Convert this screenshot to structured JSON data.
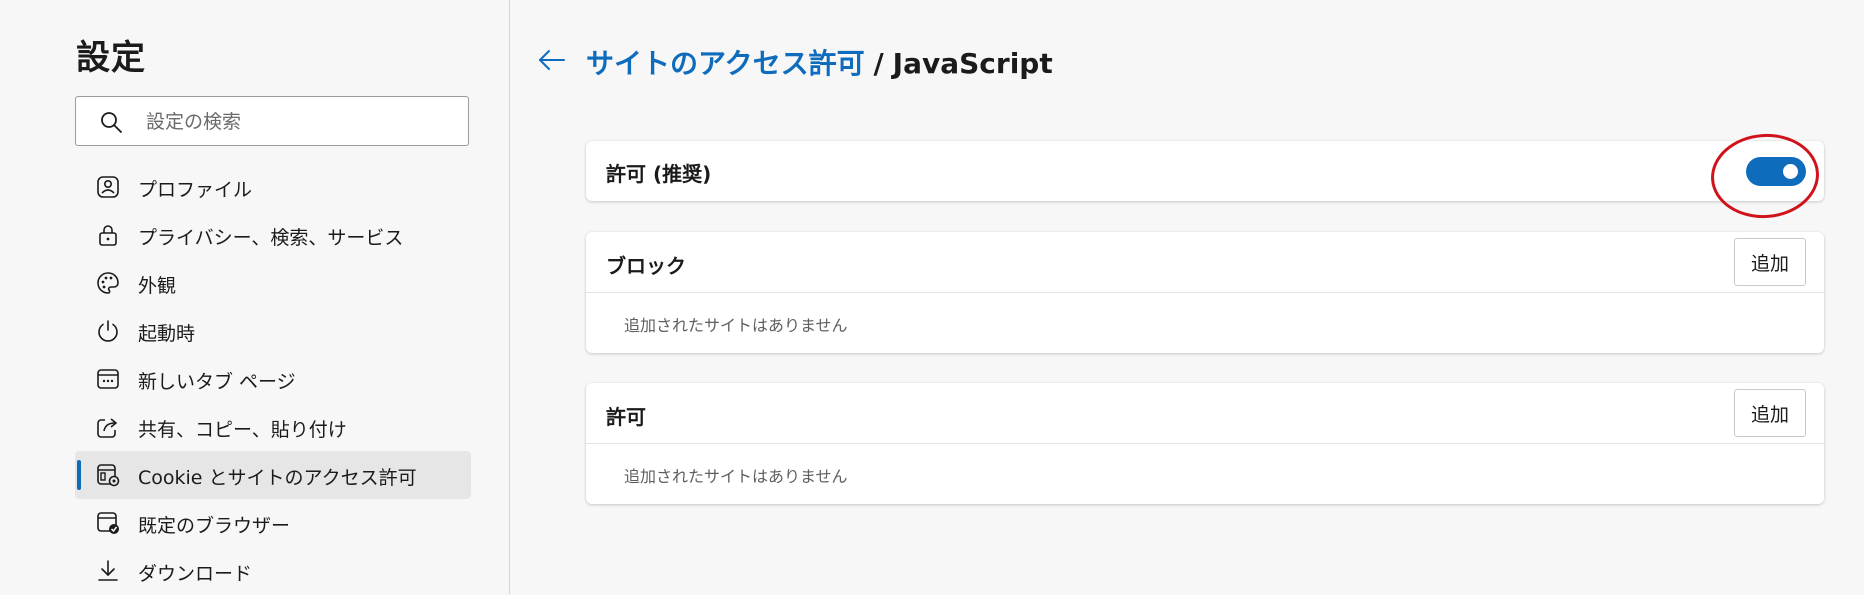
{
  "sidebar": {
    "title": "設定",
    "search": {
      "placeholder": "設定の検索",
      "value": ""
    },
    "items": [
      {
        "label": "プロファイル",
        "icon": "profile-icon",
        "active": false
      },
      {
        "label": "プライバシー、検索、サービス",
        "icon": "lock-icon",
        "active": false
      },
      {
        "label": "外観",
        "icon": "palette-icon",
        "active": false
      },
      {
        "label": "起動時",
        "icon": "power-icon",
        "active": false
      },
      {
        "label": "新しいタブ ページ",
        "icon": "new-tab-icon",
        "active": false
      },
      {
        "label": "共有、コピー、貼り付け",
        "icon": "share-icon",
        "active": false
      },
      {
        "label": "Cookie とサイトのアクセス許可",
        "icon": "site-permissions-icon",
        "active": true
      },
      {
        "label": "既定のブラウザー",
        "icon": "default-browser-icon",
        "active": false
      },
      {
        "label": "ダウンロード",
        "icon": "download-icon",
        "active": false
      }
    ]
  },
  "header": {
    "breadcrumb_link": "サイトのアクセス許可",
    "separator": "/",
    "current": "JavaScript"
  },
  "allow_setting": {
    "label": "許可 (推奨)",
    "toggle_on": true
  },
  "block_section": {
    "title": "ブロック",
    "add_label": "追加",
    "empty_text": "追加されたサイトはありません"
  },
  "allow_section": {
    "title": "許可",
    "add_label": "追加",
    "empty_text": "追加されたサイトはありません"
  },
  "colors": {
    "accent": "#0f6cbd",
    "highlight": "#d0121b",
    "background": "#f7f7f7"
  }
}
